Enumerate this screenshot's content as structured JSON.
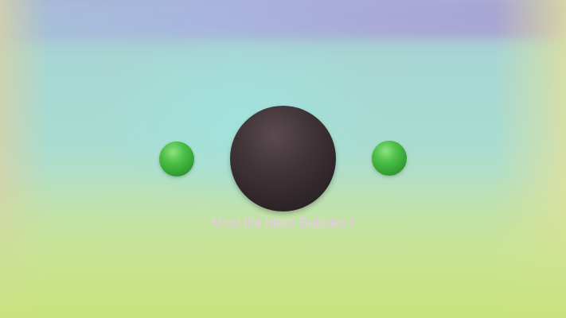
{
  "game": {
    "message": "Mind the black Bubbles !",
    "bubbles": [
      {
        "id": "left",
        "kind": "green",
        "color": "#3fae3c"
      },
      {
        "id": "center",
        "kind": "black",
        "color": "#2d2427"
      },
      {
        "id": "right",
        "kind": "green",
        "color": "#3fae3c"
      }
    ]
  },
  "colors": {
    "message_text": "#e9c9ea"
  }
}
